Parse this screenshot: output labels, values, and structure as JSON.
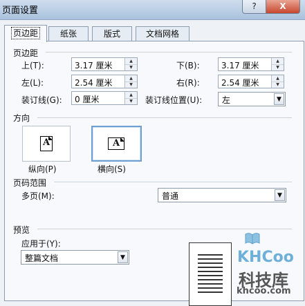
{
  "window": {
    "title": "页面设置",
    "help_label": "?",
    "close_label": "X"
  },
  "tabs": [
    {
      "label": "页边距",
      "active": true
    },
    {
      "label": "纸张",
      "active": false
    },
    {
      "label": "版式",
      "active": false
    },
    {
      "label": "文档网格",
      "active": false
    }
  ],
  "margins": {
    "section_title": "页边距",
    "top": {
      "label": "上(T):",
      "value": "3.17 厘米"
    },
    "bottom": {
      "label": "下(B):",
      "value": "3.17 厘米"
    },
    "left": {
      "label": "左(L):",
      "value": "2.54 厘米"
    },
    "right": {
      "label": "右(R):",
      "value": "2.54 厘米"
    },
    "gutter": {
      "label": "装订线(G):",
      "value": "0 厘米"
    },
    "gutter_position": {
      "label": "装订线位置(U):",
      "value": "左"
    }
  },
  "orientation": {
    "section_title": "方向",
    "portrait": {
      "label": "纵向(P)",
      "icon": "page-portrait-icon",
      "letter": "A",
      "selected": false
    },
    "landscape": {
      "label": "横向(S)",
      "icon": "page-landscape-icon",
      "letter": "A",
      "selected": true
    }
  },
  "pages": {
    "section_title": "页码范围",
    "multiple_label": "多页(M):",
    "multiple_value": "普通"
  },
  "preview": {
    "section_title": "预览",
    "apply_to_label": "应用于(Y):",
    "apply_to_value": "整篇文档"
  },
  "watermark": {
    "brand": "KHCoo",
    "name_cn": "科技库",
    "url": "khcoo.com"
  },
  "colors": {
    "selected_border": "#6d9fd2",
    "watermark_blue": "#6fb0da"
  }
}
